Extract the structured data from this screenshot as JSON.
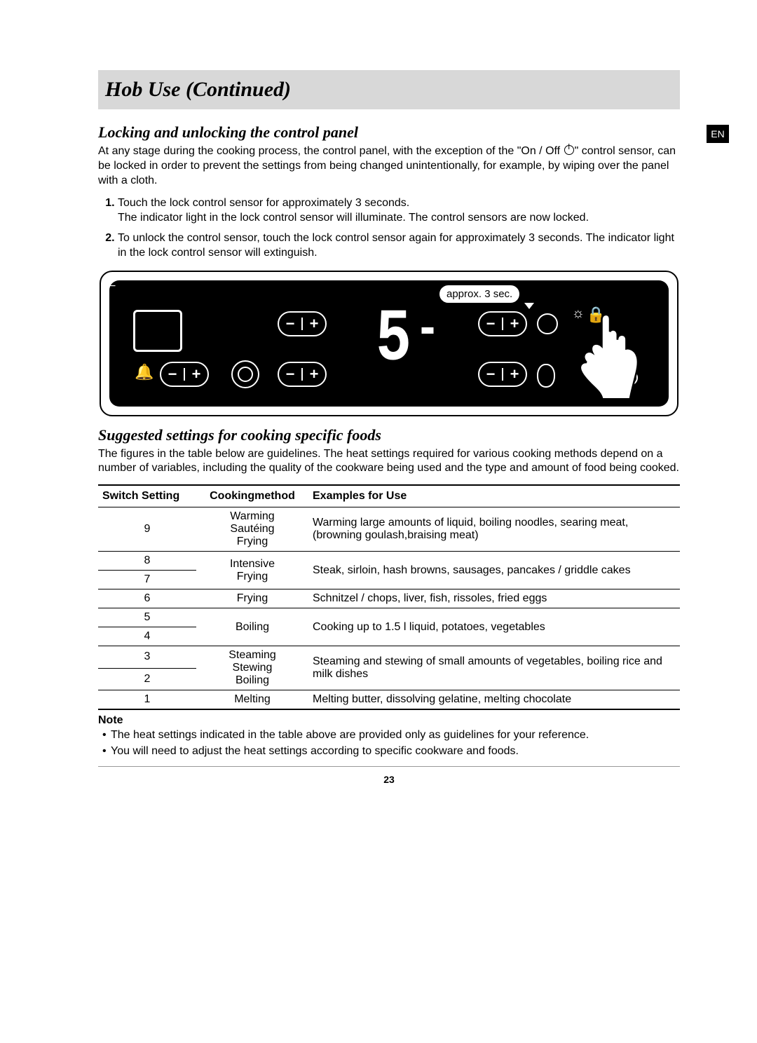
{
  "lang_badge": "EN",
  "title": "Hob Use (Continued)",
  "sec1": {
    "heading": "Locking and unlocking the control panel",
    "intro_a": "At any stage during the cooking process, the control panel, with the exception of the \"On / Off",
    "intro_b": "\" control sensor, can be locked in order to prevent the settings from being changed unintentionally, for example, by wiping over the panel with a cloth.",
    "steps": [
      "Touch the lock control sensor for approximately 3 seconds.\nThe indicator light in the lock control sensor will illuminate. The control sensors are now locked.",
      "To unlock the control sensor, touch the lock control sensor again for approximately 3 seconds. The indicator light in the lock control sensor will extinguish."
    ],
    "speech": "approx. 3 sec."
  },
  "sec2": {
    "heading": "Suggested settings for cooking specific foods",
    "intro": "The figures in the table below are guidelines. The heat settings required for various cooking methods depend on a number of variables, including the quality of the cookware being used and the type and amount of food being cooked.",
    "headers": [
      "Switch Setting",
      "Cookingmethod",
      "Examples for Use"
    ]
  },
  "chart_data": {
    "type": "table",
    "headers": [
      "Switch Setting",
      "Cookingmethod",
      "Examples for Use"
    ],
    "rows": [
      {
        "setting": "9",
        "method": "Warming\nSautéing\nFrying",
        "example": "Warming large amounts of liquid, boiling noodles, searing meat, (browning goulash,braising meat)"
      },
      {
        "setting": "8",
        "method_group": "Intensive Frying",
        "example_group": "Steak, sirloin, hash browns, sausages, pancakes / griddle cakes"
      },
      {
        "setting": "7"
      },
      {
        "setting": "6",
        "method": "Frying",
        "example": "Schnitzel / chops, liver, fish, rissoles, fried eggs"
      },
      {
        "setting": "5",
        "method_group": "Boiling",
        "example_group": "Cooking up to 1.5 l liquid, potatoes, vegetables"
      },
      {
        "setting": "4"
      },
      {
        "setting": "3",
        "method_group": "Steaming Stewing Boiling",
        "example_group": "Steaming and stewing of small amounts of vegetables, boiling rice and milk dishes"
      },
      {
        "setting": "2"
      },
      {
        "setting": "1",
        "method": "Melting",
        "example": "Melting butter, dissolving gelatine, melting chocolate"
      }
    ]
  },
  "note": {
    "head": "Note",
    "items": [
      "The heat settings indicated in the table above are provided only as guidelines for your reference.",
      "You will need to adjust the heat settings according to specific cookware and foods."
    ]
  },
  "page_number": "23",
  "t": {
    "r9s": "9",
    "r9m": "Warming\nSautéing\nFrying",
    "r9e": "Warming large amounts of liquid, boiling noodles, searing meat, (browning goulash,braising meat)",
    "r8s": "8",
    "r87m": "Intensive\nFrying",
    "r87e": "Steak, sirloin, hash browns, sausages, pancakes / griddle cakes",
    "r7s": "7",
    "r6s": "6",
    "r6m": "Frying",
    "r6e": "Schnitzel / chops, liver, fish, rissoles, fried eggs",
    "r5s": "5",
    "r54m": "Boiling",
    "r54e": "Cooking up to 1.5 l liquid, potatoes, vegetables",
    "r4s": "4",
    "r3s": "3",
    "r32m": "Steaming\nStewing\nBoiling",
    "r32e": "Steaming and stewing of small amounts of vegetables, boiling rice and milk dishes",
    "r2s": "2",
    "r1s": "1",
    "r1m": "Melting",
    "r1e": "Melting butter, dissolving gelatine, melting chocolate"
  }
}
